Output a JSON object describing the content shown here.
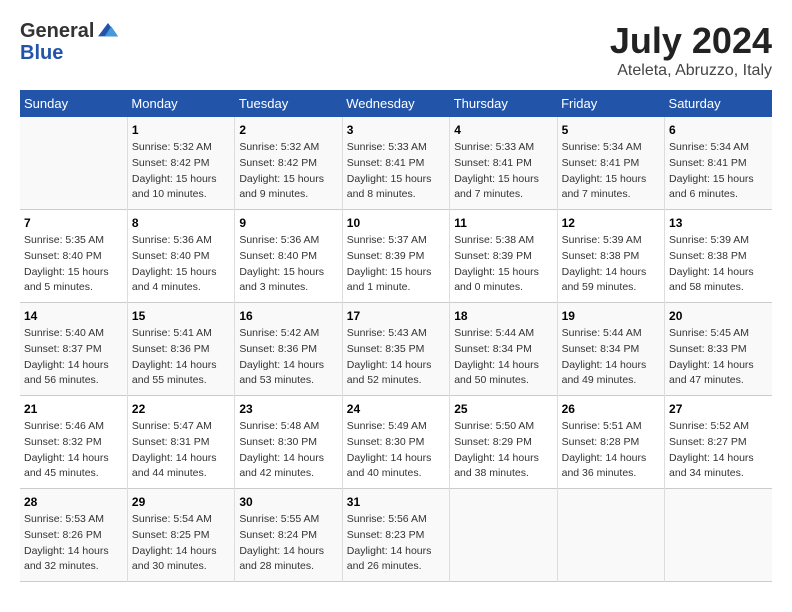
{
  "header": {
    "logo_general": "General",
    "logo_blue": "Blue",
    "month": "July 2024",
    "location": "Ateleta, Abruzzo, Italy"
  },
  "days_of_week": [
    "Sunday",
    "Monday",
    "Tuesday",
    "Wednesday",
    "Thursday",
    "Friday",
    "Saturday"
  ],
  "weeks": [
    [
      {
        "day": "",
        "info": ""
      },
      {
        "day": "1",
        "info": "Sunrise: 5:32 AM\nSunset: 8:42 PM\nDaylight: 15 hours\nand 10 minutes."
      },
      {
        "day": "2",
        "info": "Sunrise: 5:32 AM\nSunset: 8:42 PM\nDaylight: 15 hours\nand 9 minutes."
      },
      {
        "day": "3",
        "info": "Sunrise: 5:33 AM\nSunset: 8:41 PM\nDaylight: 15 hours\nand 8 minutes."
      },
      {
        "day": "4",
        "info": "Sunrise: 5:33 AM\nSunset: 8:41 PM\nDaylight: 15 hours\nand 7 minutes."
      },
      {
        "day": "5",
        "info": "Sunrise: 5:34 AM\nSunset: 8:41 PM\nDaylight: 15 hours\nand 7 minutes."
      },
      {
        "day": "6",
        "info": "Sunrise: 5:34 AM\nSunset: 8:41 PM\nDaylight: 15 hours\nand 6 minutes."
      }
    ],
    [
      {
        "day": "7",
        "info": "Sunrise: 5:35 AM\nSunset: 8:40 PM\nDaylight: 15 hours\nand 5 minutes."
      },
      {
        "day": "8",
        "info": "Sunrise: 5:36 AM\nSunset: 8:40 PM\nDaylight: 15 hours\nand 4 minutes."
      },
      {
        "day": "9",
        "info": "Sunrise: 5:36 AM\nSunset: 8:40 PM\nDaylight: 15 hours\nand 3 minutes."
      },
      {
        "day": "10",
        "info": "Sunrise: 5:37 AM\nSunset: 8:39 PM\nDaylight: 15 hours\nand 1 minute."
      },
      {
        "day": "11",
        "info": "Sunrise: 5:38 AM\nSunset: 8:39 PM\nDaylight: 15 hours\nand 0 minutes."
      },
      {
        "day": "12",
        "info": "Sunrise: 5:39 AM\nSunset: 8:38 PM\nDaylight: 14 hours\nand 59 minutes."
      },
      {
        "day": "13",
        "info": "Sunrise: 5:39 AM\nSunset: 8:38 PM\nDaylight: 14 hours\nand 58 minutes."
      }
    ],
    [
      {
        "day": "14",
        "info": "Sunrise: 5:40 AM\nSunset: 8:37 PM\nDaylight: 14 hours\nand 56 minutes."
      },
      {
        "day": "15",
        "info": "Sunrise: 5:41 AM\nSunset: 8:36 PM\nDaylight: 14 hours\nand 55 minutes."
      },
      {
        "day": "16",
        "info": "Sunrise: 5:42 AM\nSunset: 8:36 PM\nDaylight: 14 hours\nand 53 minutes."
      },
      {
        "day": "17",
        "info": "Sunrise: 5:43 AM\nSunset: 8:35 PM\nDaylight: 14 hours\nand 52 minutes."
      },
      {
        "day": "18",
        "info": "Sunrise: 5:44 AM\nSunset: 8:34 PM\nDaylight: 14 hours\nand 50 minutes."
      },
      {
        "day": "19",
        "info": "Sunrise: 5:44 AM\nSunset: 8:34 PM\nDaylight: 14 hours\nand 49 minutes."
      },
      {
        "day": "20",
        "info": "Sunrise: 5:45 AM\nSunset: 8:33 PM\nDaylight: 14 hours\nand 47 minutes."
      }
    ],
    [
      {
        "day": "21",
        "info": "Sunrise: 5:46 AM\nSunset: 8:32 PM\nDaylight: 14 hours\nand 45 minutes."
      },
      {
        "day": "22",
        "info": "Sunrise: 5:47 AM\nSunset: 8:31 PM\nDaylight: 14 hours\nand 44 minutes."
      },
      {
        "day": "23",
        "info": "Sunrise: 5:48 AM\nSunset: 8:30 PM\nDaylight: 14 hours\nand 42 minutes."
      },
      {
        "day": "24",
        "info": "Sunrise: 5:49 AM\nSunset: 8:30 PM\nDaylight: 14 hours\nand 40 minutes."
      },
      {
        "day": "25",
        "info": "Sunrise: 5:50 AM\nSunset: 8:29 PM\nDaylight: 14 hours\nand 38 minutes."
      },
      {
        "day": "26",
        "info": "Sunrise: 5:51 AM\nSunset: 8:28 PM\nDaylight: 14 hours\nand 36 minutes."
      },
      {
        "day": "27",
        "info": "Sunrise: 5:52 AM\nSunset: 8:27 PM\nDaylight: 14 hours\nand 34 minutes."
      }
    ],
    [
      {
        "day": "28",
        "info": "Sunrise: 5:53 AM\nSunset: 8:26 PM\nDaylight: 14 hours\nand 32 minutes."
      },
      {
        "day": "29",
        "info": "Sunrise: 5:54 AM\nSunset: 8:25 PM\nDaylight: 14 hours\nand 30 minutes."
      },
      {
        "day": "30",
        "info": "Sunrise: 5:55 AM\nSunset: 8:24 PM\nDaylight: 14 hours\nand 28 minutes."
      },
      {
        "day": "31",
        "info": "Sunrise: 5:56 AM\nSunset: 8:23 PM\nDaylight: 14 hours\nand 26 minutes."
      },
      {
        "day": "",
        "info": ""
      },
      {
        "day": "",
        "info": ""
      },
      {
        "day": "",
        "info": ""
      }
    ]
  ]
}
